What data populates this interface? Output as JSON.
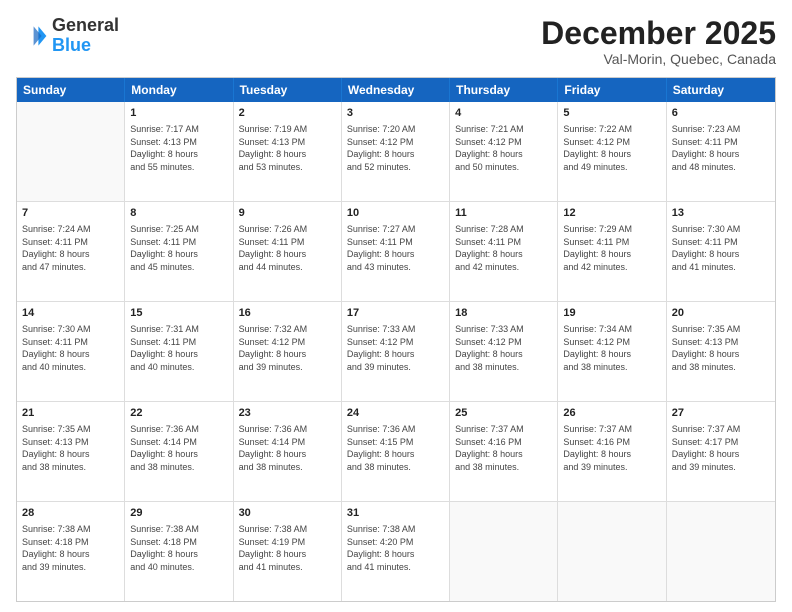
{
  "header": {
    "logo_general": "General",
    "logo_blue": "Blue",
    "month_title": "December 2025",
    "location": "Val-Morin, Quebec, Canada"
  },
  "days_of_week": [
    "Sunday",
    "Monday",
    "Tuesday",
    "Wednesday",
    "Thursday",
    "Friday",
    "Saturday"
  ],
  "weeks": [
    [
      {
        "day": "",
        "info": ""
      },
      {
        "day": "1",
        "info": "Sunrise: 7:17 AM\nSunset: 4:13 PM\nDaylight: 8 hours\nand 55 minutes."
      },
      {
        "day": "2",
        "info": "Sunrise: 7:19 AM\nSunset: 4:13 PM\nDaylight: 8 hours\nand 53 minutes."
      },
      {
        "day": "3",
        "info": "Sunrise: 7:20 AM\nSunset: 4:12 PM\nDaylight: 8 hours\nand 52 minutes."
      },
      {
        "day": "4",
        "info": "Sunrise: 7:21 AM\nSunset: 4:12 PM\nDaylight: 8 hours\nand 50 minutes."
      },
      {
        "day": "5",
        "info": "Sunrise: 7:22 AM\nSunset: 4:12 PM\nDaylight: 8 hours\nand 49 minutes."
      },
      {
        "day": "6",
        "info": "Sunrise: 7:23 AM\nSunset: 4:11 PM\nDaylight: 8 hours\nand 48 minutes."
      }
    ],
    [
      {
        "day": "7",
        "info": "Sunrise: 7:24 AM\nSunset: 4:11 PM\nDaylight: 8 hours\nand 47 minutes."
      },
      {
        "day": "8",
        "info": "Sunrise: 7:25 AM\nSunset: 4:11 PM\nDaylight: 8 hours\nand 45 minutes."
      },
      {
        "day": "9",
        "info": "Sunrise: 7:26 AM\nSunset: 4:11 PM\nDaylight: 8 hours\nand 44 minutes."
      },
      {
        "day": "10",
        "info": "Sunrise: 7:27 AM\nSunset: 4:11 PM\nDaylight: 8 hours\nand 43 minutes."
      },
      {
        "day": "11",
        "info": "Sunrise: 7:28 AM\nSunset: 4:11 PM\nDaylight: 8 hours\nand 42 minutes."
      },
      {
        "day": "12",
        "info": "Sunrise: 7:29 AM\nSunset: 4:11 PM\nDaylight: 8 hours\nand 42 minutes."
      },
      {
        "day": "13",
        "info": "Sunrise: 7:30 AM\nSunset: 4:11 PM\nDaylight: 8 hours\nand 41 minutes."
      }
    ],
    [
      {
        "day": "14",
        "info": "Sunrise: 7:30 AM\nSunset: 4:11 PM\nDaylight: 8 hours\nand 40 minutes."
      },
      {
        "day": "15",
        "info": "Sunrise: 7:31 AM\nSunset: 4:11 PM\nDaylight: 8 hours\nand 40 minutes."
      },
      {
        "day": "16",
        "info": "Sunrise: 7:32 AM\nSunset: 4:12 PM\nDaylight: 8 hours\nand 39 minutes."
      },
      {
        "day": "17",
        "info": "Sunrise: 7:33 AM\nSunset: 4:12 PM\nDaylight: 8 hours\nand 39 minutes."
      },
      {
        "day": "18",
        "info": "Sunrise: 7:33 AM\nSunset: 4:12 PM\nDaylight: 8 hours\nand 38 minutes."
      },
      {
        "day": "19",
        "info": "Sunrise: 7:34 AM\nSunset: 4:12 PM\nDaylight: 8 hours\nand 38 minutes."
      },
      {
        "day": "20",
        "info": "Sunrise: 7:35 AM\nSunset: 4:13 PM\nDaylight: 8 hours\nand 38 minutes."
      }
    ],
    [
      {
        "day": "21",
        "info": "Sunrise: 7:35 AM\nSunset: 4:13 PM\nDaylight: 8 hours\nand 38 minutes."
      },
      {
        "day": "22",
        "info": "Sunrise: 7:36 AM\nSunset: 4:14 PM\nDaylight: 8 hours\nand 38 minutes."
      },
      {
        "day": "23",
        "info": "Sunrise: 7:36 AM\nSunset: 4:14 PM\nDaylight: 8 hours\nand 38 minutes."
      },
      {
        "day": "24",
        "info": "Sunrise: 7:36 AM\nSunset: 4:15 PM\nDaylight: 8 hours\nand 38 minutes."
      },
      {
        "day": "25",
        "info": "Sunrise: 7:37 AM\nSunset: 4:16 PM\nDaylight: 8 hours\nand 38 minutes."
      },
      {
        "day": "26",
        "info": "Sunrise: 7:37 AM\nSunset: 4:16 PM\nDaylight: 8 hours\nand 39 minutes."
      },
      {
        "day": "27",
        "info": "Sunrise: 7:37 AM\nSunset: 4:17 PM\nDaylight: 8 hours\nand 39 minutes."
      }
    ],
    [
      {
        "day": "28",
        "info": "Sunrise: 7:38 AM\nSunset: 4:18 PM\nDaylight: 8 hours\nand 39 minutes."
      },
      {
        "day": "29",
        "info": "Sunrise: 7:38 AM\nSunset: 4:18 PM\nDaylight: 8 hours\nand 40 minutes."
      },
      {
        "day": "30",
        "info": "Sunrise: 7:38 AM\nSunset: 4:19 PM\nDaylight: 8 hours\nand 41 minutes."
      },
      {
        "day": "31",
        "info": "Sunrise: 7:38 AM\nSunset: 4:20 PM\nDaylight: 8 hours\nand 41 minutes."
      },
      {
        "day": "",
        "info": ""
      },
      {
        "day": "",
        "info": ""
      },
      {
        "day": "",
        "info": ""
      }
    ]
  ]
}
